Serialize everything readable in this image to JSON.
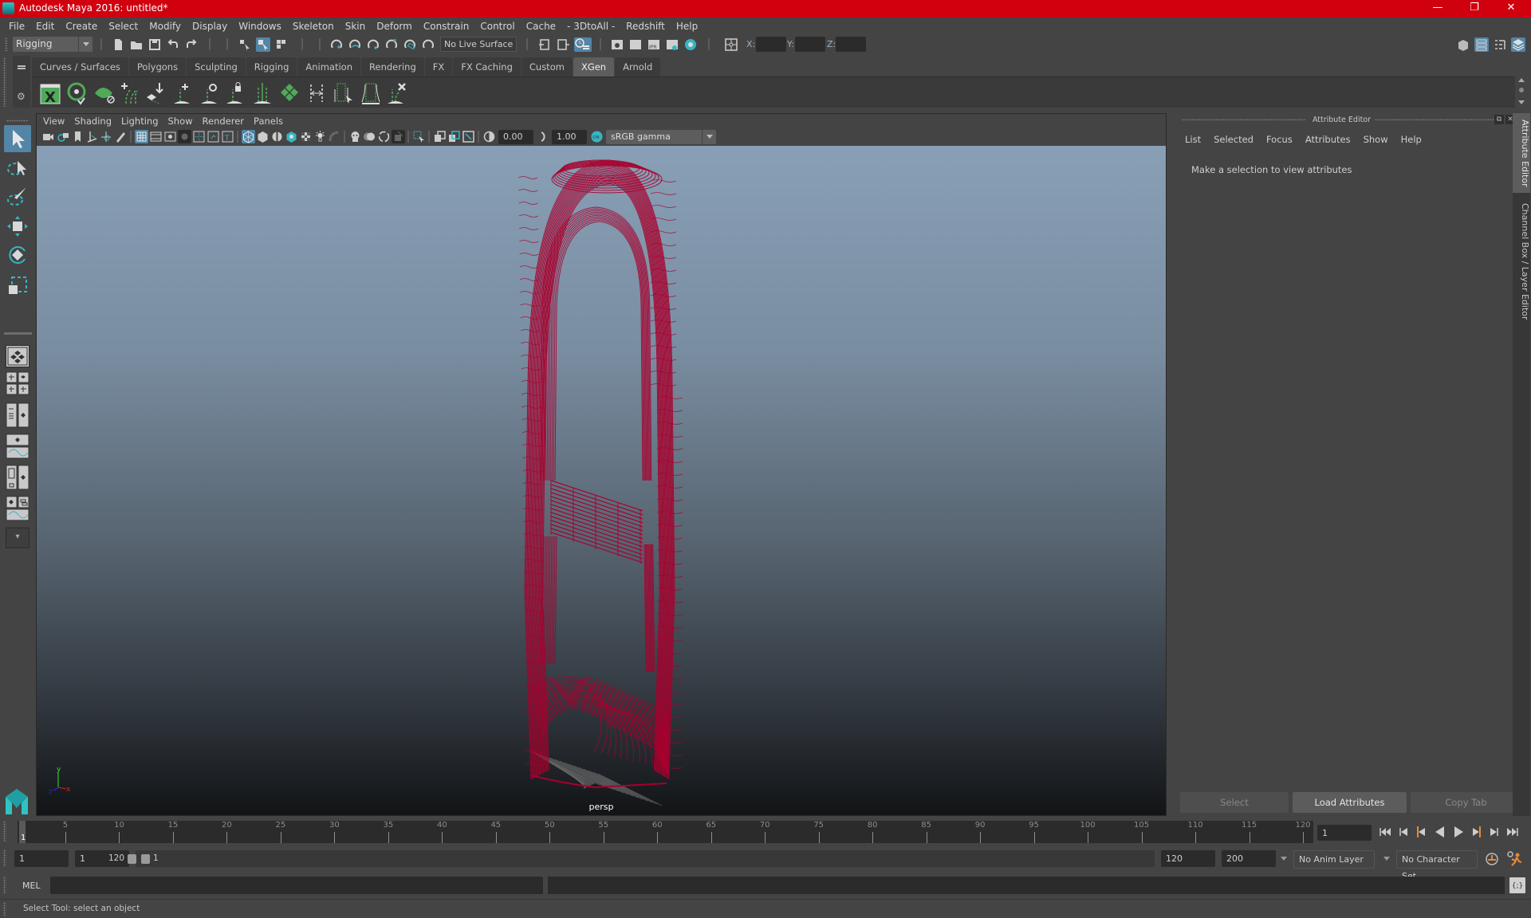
{
  "window": {
    "title": "Autodesk Maya 2016: untitled*",
    "controls": {
      "minimize": "—",
      "restore": "❐",
      "close": "✕"
    }
  },
  "menubar": {
    "items": [
      "File",
      "Edit",
      "Create",
      "Select",
      "Modify",
      "Display",
      "Windows",
      "Skeleton",
      "Skin",
      "Deform",
      "Constrain",
      "Control",
      "Cache",
      "- 3DtoAll -",
      "Redshift",
      "Help"
    ]
  },
  "statusline": {
    "menu_set": "Rigging",
    "live_surface": "No Live Surface",
    "xyz_labels": {
      "x": "X:",
      "y": "Y:",
      "z": "Z:"
    },
    "xyz_values": {
      "x": "",
      "y": "",
      "z": ""
    }
  },
  "shelf": {
    "tabs": [
      {
        "label": "Curves / Surfaces",
        "active": false
      },
      {
        "label": "Polygons",
        "active": false
      },
      {
        "label": "Sculpting",
        "active": false
      },
      {
        "label": "Rigging",
        "active": false
      },
      {
        "label": "Animation",
        "active": false
      },
      {
        "label": "Rendering",
        "active": false
      },
      {
        "label": "FX",
        "active": false
      },
      {
        "label": "FX Caching",
        "active": false
      },
      {
        "label": "Custom",
        "active": false
      },
      {
        "label": "XGen",
        "active": true
      },
      {
        "label": "Arnold",
        "active": false
      }
    ],
    "icons": [
      "xgen-window-icon",
      "xgen-preview-icon",
      "xgen-clear-icon",
      "add-guides-icon",
      "move-guides-icon",
      "add-guide-icon",
      "select-guide-icon",
      "lock-guide-icon",
      "guide-length-icon",
      "sculpt-grid-icon",
      "guide-bend-icon",
      "select-guides-tool-icon",
      "guide-box-icon",
      "delete-guides-icon"
    ],
    "accent_color": "#4faa5a"
  },
  "toolbox": {
    "tools": [
      "select-tool-icon",
      "lasso-tool-icon",
      "paint-select-tool-icon",
      "move-tool-icon",
      "rotate-tool-icon",
      "scale-tool-icon"
    ],
    "layouts": [
      "single-perspective-layout",
      "four-view-layout",
      "persp-outliner-layout",
      "persp-graph-layout",
      "hypershade-persp-layout",
      "persp-graph-hypergraph-layout"
    ]
  },
  "viewport": {
    "menu": [
      "View",
      "Shading",
      "Lighting",
      "Show",
      "Renderer",
      "Panels"
    ],
    "exposure": "0.00",
    "gamma": "1.00",
    "color_space": "sRGB gamma",
    "camera": "persp",
    "wireframe_color": "#a8002e",
    "axis": {
      "x": "x",
      "y": "y",
      "z": "z"
    }
  },
  "attribute_editor": {
    "title": "Attribute Editor",
    "menu": [
      "List",
      "Selected",
      "Focus",
      "Attributes",
      "Show",
      "Help"
    ],
    "message": "Make a selection to view attributes",
    "buttons": {
      "select": "Select",
      "load": "Load Attributes",
      "copy": "Copy Tab"
    }
  },
  "side_tabs": {
    "attribute_editor": "Attribute Editor",
    "channel_box": "Channel Box / Layer Editor"
  },
  "timeline": {
    "start": 1,
    "end": 120,
    "current_frame": "1",
    "tick_labels": [
      5,
      10,
      15,
      20,
      25,
      30,
      35,
      40,
      45,
      50,
      55,
      60,
      65,
      70,
      75,
      80,
      85,
      90,
      95,
      100,
      105,
      110,
      115,
      120
    ],
    "current_frame_field": "1",
    "playback": [
      "go-to-start-icon",
      "step-back-key-icon",
      "step-back-frame-icon",
      "play-backwards-icon",
      "play-forwards-icon",
      "step-forward-frame-icon",
      "step-forward-key-icon",
      "go-to-end-icon"
    ]
  },
  "range": {
    "anim_start": "1",
    "playback_start": "1",
    "slider_start_label": "1",
    "slider_end_label": "120",
    "playback_end": "120",
    "anim_end": "200",
    "anim_layer": "No Anim Layer",
    "character_set": "No Character Set"
  },
  "command_line": {
    "label": "MEL",
    "input": "",
    "output": ""
  },
  "help_line": {
    "text": "Select Tool: select an object"
  }
}
